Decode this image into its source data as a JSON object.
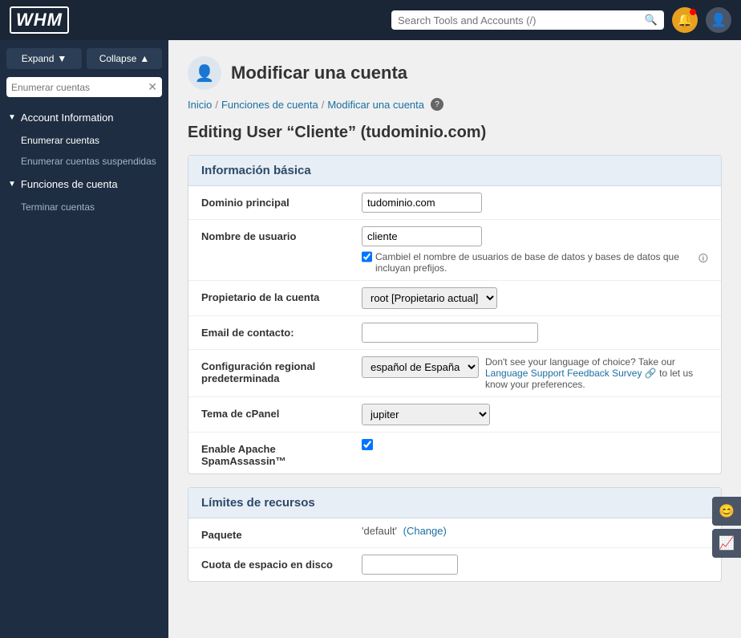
{
  "topbar": {
    "logo": "WHM",
    "search_placeholder": "Search Tools and Accounts (/)",
    "search_shortcut": "/"
  },
  "sidebar": {
    "expand_label": "Expand",
    "collapse_label": "Collapse",
    "search_placeholder": "Enumerar cuentas",
    "sections": [
      {
        "id": "account-information",
        "label": "Account Information",
        "expanded": true,
        "items": [
          {
            "id": "enumerar-cuentas",
            "label": "Enumerar cuentas",
            "active": true
          },
          {
            "id": "enumerar-cuentas-suspendidas",
            "label": "Enumerar cuentas suspendidas"
          }
        ]
      },
      {
        "id": "funciones-de-cuenta",
        "label": "Funciones de cuenta",
        "expanded": true,
        "items": [
          {
            "id": "terminar-cuentas",
            "label": "Terminar cuentas"
          }
        ]
      }
    ]
  },
  "page": {
    "title": "Modificar una cuenta",
    "editing_title": "Editing User “Cliente” (tudominio.com)",
    "breadcrumb": {
      "home": "Inicio",
      "section": "Funciones de cuenta",
      "current": "Modificar una cuenta"
    }
  },
  "basic_info": {
    "section_title": "Información básica",
    "fields": {
      "dominio_principal_label": "Dominio principal",
      "dominio_principal_value": "tudominio.com",
      "nombre_usuario_label": "Nombre de usuario",
      "nombre_usuario_value": "cliente",
      "checkbox_label": "Cambiel el nombre de usuarios de base de datos y bases de datos que incluyan prefijos.",
      "propietario_label": "Propietario de la cuenta",
      "propietario_value": "root [Propietario actual]",
      "email_label": "Email de contacto:",
      "email_value": "",
      "config_regional_label": "Configuración regional predeterminada",
      "locale_value": "español de España",
      "locale_hint": "Don't see your language of choice? Take our",
      "locale_link": "Language Support Feedback Survey",
      "locale_suffix": "to let us know your preferences.",
      "tema_cpanel_label": "Tema de cPanel",
      "tema_cpanel_value": "jupiter",
      "spamassassin_label": "Enable Apache SpamAssassin™"
    }
  },
  "recursos": {
    "section_title": "Límites de recursos",
    "fields": {
      "paquete_label": "Paquete",
      "paquete_value": "'default'",
      "paquete_change": "(Change)",
      "cuota_label": "Cuota de espacio en disco"
    }
  },
  "icons": {
    "search": "🔍",
    "bell": "🔔",
    "user": "👤",
    "page_icon": "👤",
    "help": "?",
    "chevron_down": "▼",
    "expand_arrow": "▼",
    "collapse_arrow": "▲",
    "smiley": "😊",
    "chart": "📈"
  }
}
